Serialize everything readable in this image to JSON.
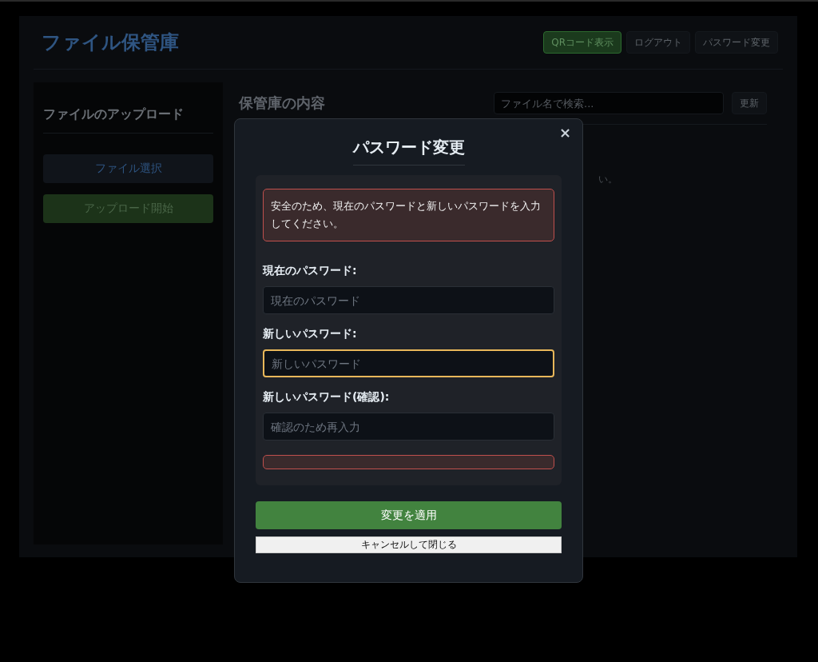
{
  "header": {
    "title": "ファイル保管庫",
    "buttons": [
      {
        "label": "QRコード表示",
        "kind": "primary"
      },
      {
        "label": "ログアウト",
        "kind": "plain"
      },
      {
        "label": "パスワード変更",
        "kind": "plain"
      }
    ]
  },
  "sidebar": {
    "title": "ファイルのアップロード",
    "buttons": [
      {
        "label": "ファイル選択",
        "kind": "select"
      },
      {
        "label": "アップロード開始",
        "kind": "upload"
      }
    ]
  },
  "main": {
    "title": "保管庫の内容",
    "search": {
      "placeholder": "ファイル名で検索..."
    },
    "refresh_button": "更新",
    "message": "い。"
  },
  "modal": {
    "close": "×",
    "title": "パスワード変更",
    "notice": "安全のため、現在のパスワードと新しいパスワードを入力してください。",
    "fields": [
      {
        "label": "現在のパスワード:",
        "placeholder": "現在のパスワード",
        "focused": false
      },
      {
        "label": "新しいパスワード:",
        "placeholder": "新しいパスワード",
        "focused": true
      },
      {
        "label": "新しいパスワード(確認):",
        "placeholder": "確認のため再入力",
        "focused": false
      }
    ],
    "apply_button": "変更を適用",
    "cancel_button": "キャンセルして閉じる"
  }
}
